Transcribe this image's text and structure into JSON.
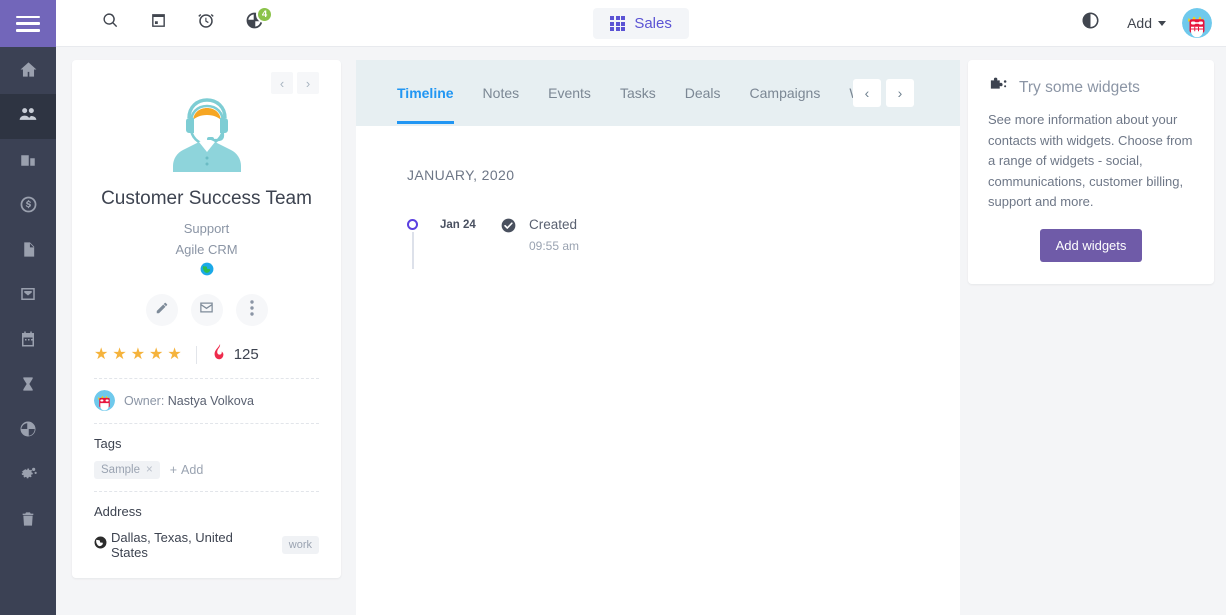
{
  "sidebar": {
    "menu_icon": "hamburger-menu-icon",
    "items": [
      {
        "name": "home",
        "icon": "home-icon",
        "active": false
      },
      {
        "name": "contacts",
        "icon": "people-icon",
        "active": true
      },
      {
        "name": "companies",
        "icon": "building-icon",
        "active": false
      },
      {
        "name": "deals",
        "icon": "dollar-icon",
        "active": false
      },
      {
        "name": "documents",
        "icon": "document-icon",
        "active": false
      },
      {
        "name": "inbox",
        "icon": "inbox-icon",
        "active": false
      },
      {
        "name": "calendar",
        "icon": "calendar-icon",
        "active": false
      },
      {
        "name": "workflows",
        "icon": "hourglass-icon",
        "active": false
      },
      {
        "name": "reports",
        "icon": "pie-chart-icon",
        "active": false
      },
      {
        "name": "settings",
        "icon": "gears-icon",
        "active": false
      },
      {
        "name": "trash",
        "icon": "trash-icon",
        "active": false
      }
    ]
  },
  "topbar": {
    "icons": [
      {
        "name": "search-icon",
        "badge": null
      },
      {
        "name": "calendar-icon",
        "badge": null
      },
      {
        "name": "alarm-clock-icon",
        "badge": null
      },
      {
        "name": "pie-chart-icon",
        "badge": "4"
      }
    ],
    "sales_label": "Sales",
    "sales_icon": "grid-icon",
    "contrast_icon": "contrast-icon",
    "add_label": "Add",
    "avatar": "user-avatar"
  },
  "contact": {
    "prev_label": "‹",
    "next_label": "›",
    "name": "Customer Success Team",
    "role": "Support",
    "organization": "Agile CRM",
    "website_icon": "globe-icon",
    "actions": [
      {
        "name": "edit-contact-button",
        "icon": "pencil-icon"
      },
      {
        "name": "send-email-button",
        "icon": "envelope-icon"
      },
      {
        "name": "more-options-button",
        "icon": "vertical-dots-icon"
      }
    ],
    "stars": 5,
    "star_glyph": "★",
    "score_icon": "flame-icon",
    "score": "125",
    "owner_prefix": "Owner:",
    "owner_name": "Nastya Volkova",
    "tags_title": "Tags",
    "tags": [
      {
        "label": "Sample",
        "remove": "×"
      }
    ],
    "add_tag_label": "Add",
    "address_title": "Address",
    "address": "Dallas, Texas, United States",
    "address_type": "work",
    "address_icon": "globe-icon"
  },
  "main": {
    "tabs": [
      {
        "label": "Timeline",
        "active": true
      },
      {
        "label": "Notes",
        "active": false
      },
      {
        "label": "Events",
        "active": false
      },
      {
        "label": "Tasks",
        "active": false
      },
      {
        "label": "Deals",
        "active": false
      },
      {
        "label": "Campaigns",
        "active": false
      },
      {
        "label": "We",
        "active": false
      }
    ],
    "tab_prev": "‹",
    "tab_next": "›",
    "timeline": {
      "month": "JANUARY, 2020",
      "entries": [
        {
          "date": "Jan 24",
          "title": "Created",
          "time": "09:55 am",
          "icon": "check-circle-icon"
        }
      ]
    }
  },
  "widgets": {
    "icon": "puzzle-piece-icon",
    "title": "Try some widgets",
    "body": "See more information about your contacts with widgets. Choose from a range of widgets - social, communications, customer billing, support and more.",
    "button_label": "Add widgets"
  },
  "colors": {
    "brand_purple": "#7266ba",
    "sidebar_dark": "#3b4154",
    "accent_blue": "#2196f3",
    "sales_purple": "#5b53d4",
    "widget_button": "#6f5ba8",
    "badge_green": "#8bc34a",
    "star_gold": "#f5b33c",
    "timeline_dot": "#5b3fe0"
  }
}
